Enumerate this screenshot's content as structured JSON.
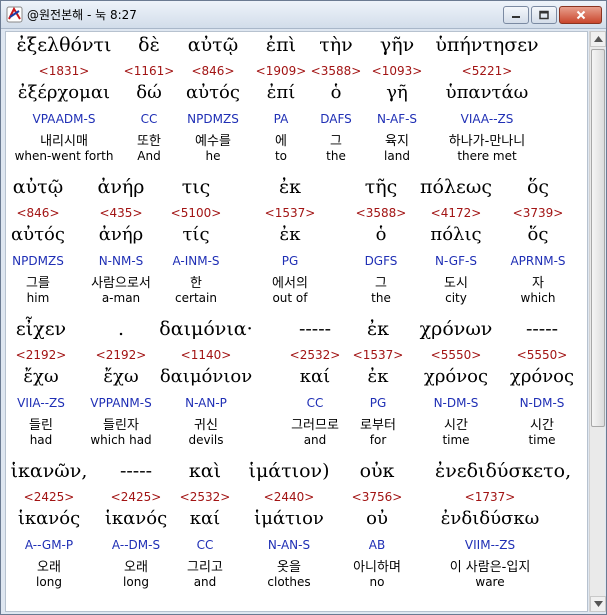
{
  "window": {
    "title": "@원전본해 - 눅 8:27"
  },
  "rows": [
    [
      {
        "greek": "ἐξελθόντι",
        "num": "<1831>",
        "lemma": "ἐξέρχομαι",
        "morph": "VPAADM-S",
        "korean": "내리시매",
        "english": "when-went forth"
      },
      {
        "greek": "δὲ",
        "num": "<1161>",
        "lemma": "δώ",
        "morph": "CC",
        "korean": "또한",
        "english": "And"
      },
      {
        "greek": "αὐτῷ",
        "num": "<846>",
        "lemma": "αὐτός",
        "morph": "NPDMZS",
        "korean": "예수를",
        "english": "he"
      },
      {
        "greek": "ἐπὶ",
        "num": "<1909>",
        "lemma": "ἐπί",
        "morph": "PA",
        "korean": "에",
        "english": "to"
      },
      {
        "greek": "τὴν",
        "num": "<3588>",
        "lemma": "ὁ",
        "morph": "DAFS",
        "korean": "그",
        "english": "the"
      },
      {
        "greek": "γῆν",
        "num": "<1093>",
        "lemma": "γῆ",
        "morph": "N-AF-S",
        "korean": "육지",
        "english": "land"
      },
      {
        "greek": "ὑπήντησεν",
        "num": "<5221>",
        "lemma": "ὑπαντάω",
        "morph": "VIAA--ZS",
        "korean": "하나가-만나니",
        "english": "there met"
      }
    ],
    [
      {
        "greek": "αὐτῷ",
        "num": "<846>",
        "lemma": "αὐτός",
        "morph": "NPDMZS",
        "korean": "그를",
        "english": "him"
      },
      {
        "greek": "ἀνήρ",
        "num": "<435>",
        "lemma": "ἀνήρ",
        "morph": "N-NM-S",
        "korean": "사람으로서",
        "english": "a-man"
      },
      {
        "greek": "τις",
        "num": "<5100>",
        "lemma": "τίς",
        "morph": "A-INM-S",
        "korean": "한",
        "english": "certain"
      },
      {
        "greek": "ἐκ",
        "num": "<1537>",
        "lemma": "ἐκ",
        "morph": "PG",
        "korean": "에서의",
        "english": "out of"
      },
      {
        "greek": "τῆς",
        "num": "<3588>",
        "lemma": "ὁ",
        "morph": "DGFS",
        "korean": "그",
        "english": "the"
      },
      {
        "greek": "πόλεως",
        "num": "<4172>",
        "lemma": "πόλις",
        "morph": "N-GF-S",
        "korean": "도시",
        "english": "city"
      },
      {
        "greek": "ὅς",
        "num": "<3739>",
        "lemma": "ὅς",
        "morph": "APRNM-S",
        "korean": "자",
        "english": "which"
      }
    ],
    [
      {
        "greek": "εἶχεν",
        "num": "<2192>",
        "lemma": "ἔχω",
        "morph": "VIIA--ZS",
        "korean": "들린",
        "english": "had"
      },
      {
        "greek": ".",
        "num": "<2192>",
        "lemma": "ἔχω",
        "morph": "VPPANM-S",
        "korean": "들린자",
        "english": "which had"
      },
      {
        "greek": "δαιμόνια·",
        "num": "<1140>",
        "lemma": "δαιμόνιον",
        "morph": "N-AN-P",
        "korean": "귀신",
        "english": "devils"
      },
      {
        "greek": "-----",
        "num": "<2532>",
        "lemma": "καί",
        "morph": "CC",
        "korean": "그러므로",
        "english": "and"
      },
      {
        "greek": "ἐκ",
        "num": "<1537>",
        "lemma": "ἐκ",
        "morph": "PG",
        "korean": "로부터",
        "english": "for"
      },
      {
        "greek": "χρόνων",
        "num": "<5550>",
        "lemma": "χρόνος",
        "morph": "N-DM-S",
        "korean": "시간",
        "english": "time"
      },
      {
        "greek": "-----",
        "num": "<5550>",
        "lemma": "χρόνος",
        "morph": "N-DM-S",
        "korean": "시간",
        "english": "time"
      }
    ],
    [
      {
        "greek": "ἱκανῶν,",
        "num": "<2425>",
        "lemma": "ἱκανός",
        "morph": "A--GM-P",
        "korean": "오래",
        "english": "long"
      },
      {
        "greek": "-----",
        "num": "<2425>",
        "lemma": "ἱκανός",
        "morph": "A--DM-S",
        "korean": "오래",
        "english": "long"
      },
      {
        "greek": "καὶ",
        "num": "<2532>",
        "lemma": "καί",
        "morph": "CC",
        "korean": "그리고",
        "english": "and"
      },
      {
        "greek": "ἱμάτιον)",
        "num": "<2440>",
        "lemma": "ἱμάτιον",
        "morph": "N-AN-S",
        "korean": "옷을",
        "english": "clothes"
      },
      {
        "greek": "οὐκ",
        "num": "<3756>",
        "lemma": "οὐ",
        "morph": "AB",
        "korean": "아니하며",
        "english": "no"
      },
      {
        "greek": "ἐνεδιδύσκετο,",
        "num": "<1737>",
        "lemma": "ἐνδιδύσκω",
        "morph": "VIIM--ZS",
        "korean": "이 사람은-입지",
        "english": "ware"
      }
    ]
  ]
}
